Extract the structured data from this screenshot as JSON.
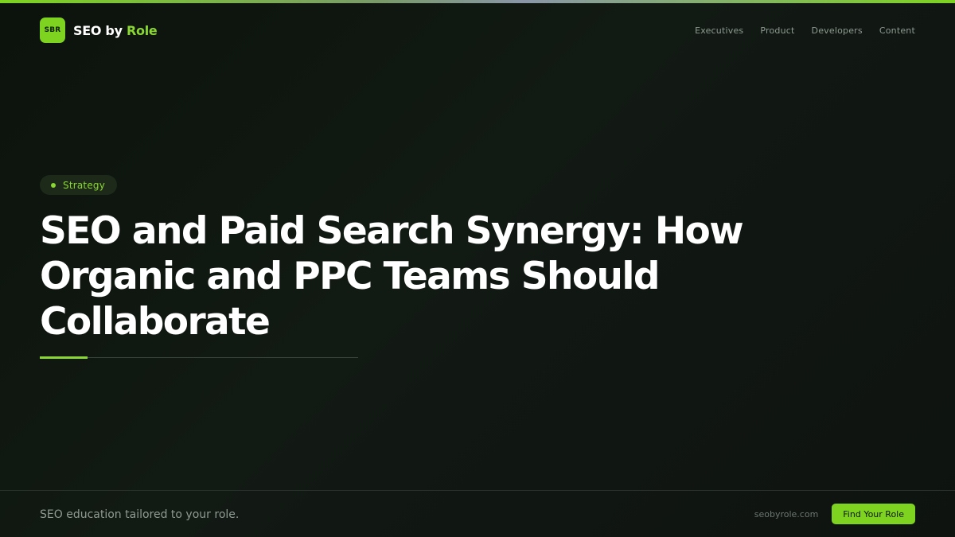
{
  "brand": {
    "logo_text": "SBR",
    "name_prefix": "SEO by",
    "name_accent": "Role"
  },
  "nav": {
    "items": [
      "Executives",
      "Product",
      "Developers",
      "Content"
    ]
  },
  "article": {
    "tag": "Strategy",
    "title": "SEO and Paid Search Synergy: How Organic and PPC Teams Should Collaborate"
  },
  "footer": {
    "tagline": "SEO education tailored to your role.",
    "domain": "seobyrole.com",
    "cta_label": "Find Your Role"
  },
  "colors": {
    "accent": "#7ed321",
    "background": "#0f140f",
    "text_primary": "#ffffff",
    "text_muted": "#8f9a92"
  }
}
